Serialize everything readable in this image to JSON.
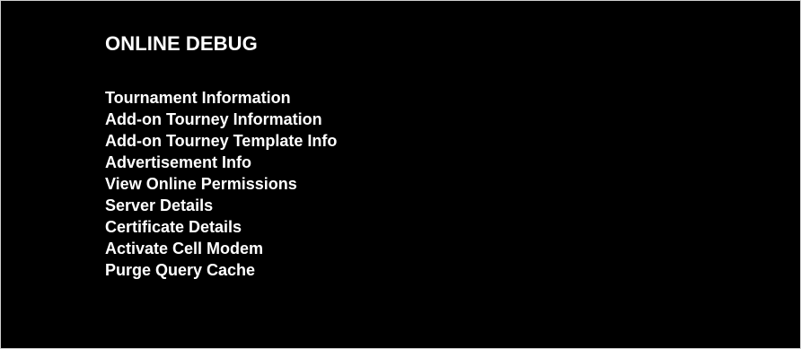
{
  "title": "ONLINE DEBUG",
  "menu": {
    "items": [
      {
        "label": "Tournament Information"
      },
      {
        "label": "Add-on Tourney Information"
      },
      {
        "label": "Add-on Tourney Template Info"
      },
      {
        "label": "Advertisement Info"
      },
      {
        "label": "View Online Permissions"
      },
      {
        "label": "Server Details"
      },
      {
        "label": "Certificate Details"
      },
      {
        "label": "Activate Cell Modem"
      },
      {
        "label": "Purge Query Cache"
      }
    ]
  },
  "colors": {
    "background": "#000000",
    "text": "#ffffff",
    "border": "#cfcfcf"
  }
}
